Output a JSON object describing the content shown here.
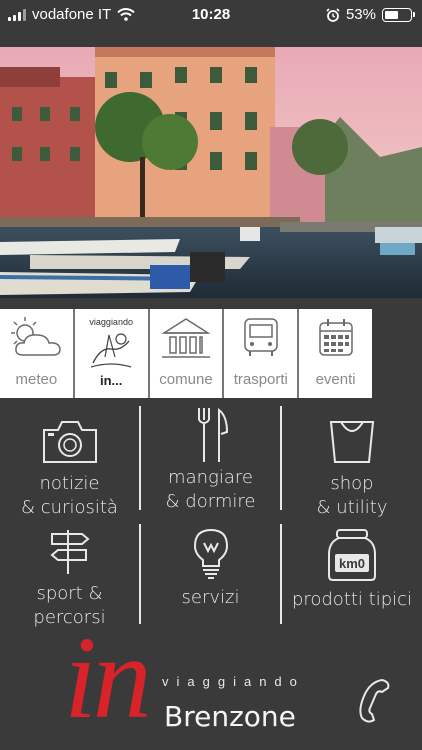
{
  "status_bar": {
    "carrier": "vodafone IT",
    "time": "10:28",
    "battery": "53%",
    "battery_level": 0.53
  },
  "hero": {
    "image_description": "lakeside village with boats"
  },
  "quick_nav": [
    {
      "label": "meteo",
      "icon": "weather-icon"
    },
    {
      "label": "in...",
      "sublabel": "viaggiando",
      "icon": "viaggiando-logo-icon"
    },
    {
      "label": "comune",
      "icon": "town-hall-icon"
    },
    {
      "label": "trasporti",
      "icon": "bus-icon"
    },
    {
      "label": "eventi",
      "icon": "calendar-icon"
    }
  ],
  "tiles": [
    {
      "label_1": "notizie",
      "label_2": "& curiosità",
      "icon": "camera-icon"
    },
    {
      "label_1": "mangiare",
      "label_2": "& dormire",
      "icon": "fork-knife-icon"
    },
    {
      "label_1": "shop",
      "label_2": "& utility",
      "icon": "shopping-bag-icon"
    },
    {
      "label_1": "sport &",
      "label_2": "percorsi",
      "icon": "signpost-icon"
    },
    {
      "label_1": "servizi",
      "label_2": "",
      "icon": "lightbulb-icon"
    },
    {
      "label_1": "prodotti tipici",
      "label_2": "",
      "icon": "jar-icon"
    }
  ],
  "jar_badge": "km0",
  "footer": {
    "brand_mark": "in",
    "tagline": "viaggiando",
    "name": "Brenzone",
    "phone_icon": "phone-icon"
  },
  "colors": {
    "background": "#3a3a3a",
    "brand_red": "#d8232a",
    "nav_label": "#8a8a8a"
  }
}
